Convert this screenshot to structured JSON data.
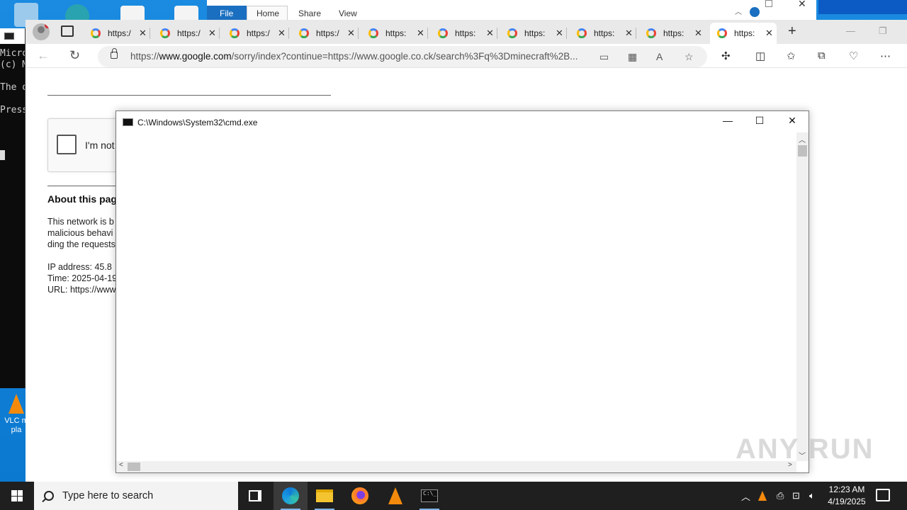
{
  "background_console": {
    "lines": [
      "Micro",
      "(c) M",
      "",
      "The o",
      "",
      "Press"
    ]
  },
  "explorer_bg": {
    "ribbon_tabs": [
      "File",
      "Home",
      "Share",
      "View"
    ]
  },
  "browser": {
    "tabs": [
      {
        "title": "https:/"
      },
      {
        "title": "https:/"
      },
      {
        "title": "https:/"
      },
      {
        "title": "https:/"
      },
      {
        "title": "https:"
      },
      {
        "title": "https:"
      },
      {
        "title": "https:"
      },
      {
        "title": "https:"
      },
      {
        "title": "https:"
      },
      {
        "title": "https:"
      }
    ],
    "active_tab_index": 9,
    "address": {
      "prefix": "https://",
      "domain": "www.google.com",
      "rest": "/sorry/index?continue=https://www.google.co.ck/search%3Fq%3Dminecraft%2B..."
    }
  },
  "page": {
    "captcha_label": "I'm not",
    "about_heading": "About this page",
    "paragraph_lines": [
      "This network is b",
      "malicious behavi",
      "ding the requests"
    ],
    "info_lines": [
      "IP address: 45.8",
      "Time: 2025-04-19",
      "URL: https://www"
    ]
  },
  "cmd_window": {
    "title": "C:\\Windows\\System32\\cmd.exe"
  },
  "desktop": {
    "vlc_label_1": "VLC m",
    "vlc_label_2": "pla"
  },
  "watermark": "ANY RUN",
  "taskbar": {
    "search_placeholder": "Type here to search",
    "time": "12:23 AM",
    "date": "4/19/2025"
  }
}
